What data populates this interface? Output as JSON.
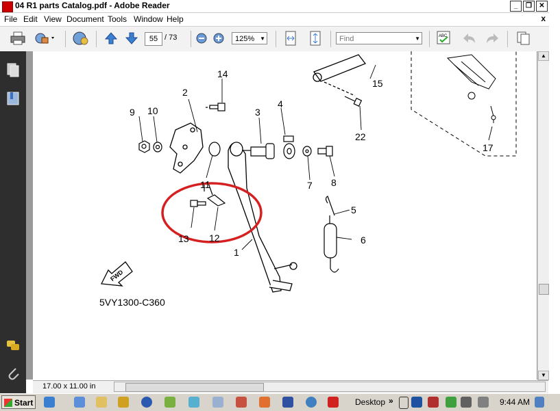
{
  "window": {
    "title": "04 R1 parts Catalog.pdf - Adobe Reader",
    "close_glyph": "x"
  },
  "menu": [
    "File",
    "Edit",
    "View",
    "Document",
    "Tools",
    "Window",
    "Help"
  ],
  "toolbar": {
    "current_page": "55",
    "page_total": "/ 73",
    "zoom": "125%",
    "find_placeholder": "Find"
  },
  "diagram": {
    "callouts": [
      "14",
      "2",
      "9",
      "10",
      "3",
      "4",
      "15",
      "22",
      "17",
      "11",
      "7",
      "8",
      "5",
      "6",
      "13",
      "12",
      "1"
    ],
    "direction_label": "FWD",
    "part_code": "5VY1300-C360"
  },
  "status": {
    "page_size": "17.00 x 11.00 in"
  },
  "taskbar": {
    "start_label": "Start",
    "desktop_label": "Desktop",
    "clock": "9:44 AM"
  },
  "colors": {
    "highlight_circle": "#d42020",
    "nav_panel": "#2e2e2e"
  }
}
